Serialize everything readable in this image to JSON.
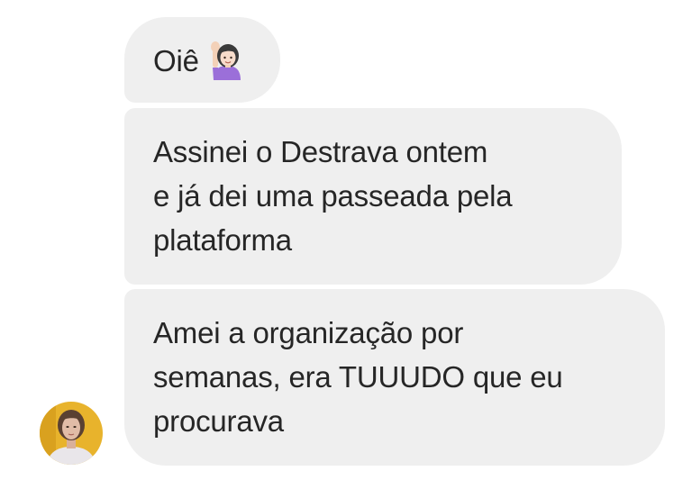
{
  "conversation": {
    "messages": [
      {
        "lines": [
          "Oiê"
        ],
        "emoji": "person-raising-hand-emoji"
      },
      {
        "lines": [
          "Assinei o Destrava ontem",
          "e já dei uma passeada pela",
          "plataforma"
        ]
      },
      {
        "lines": [
          "Amei a organização por",
          "semanas, era TUUUDO que eu",
          "procurava"
        ]
      }
    ],
    "sender_avatar": "woman-profile-photo",
    "colors": {
      "bubble": "#efefef",
      "text": "#262626",
      "avatar_bg": "#e8b32c",
      "emoji_shirt": "#9b6fd9"
    }
  }
}
